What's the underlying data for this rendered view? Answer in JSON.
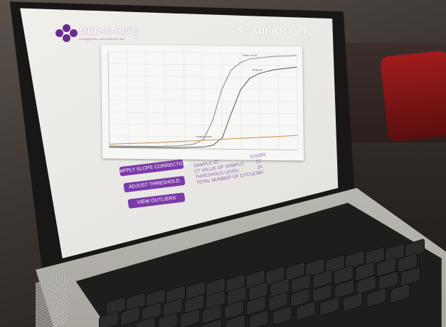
{
  "app": {
    "brand": "MED-E-HIVE",
    "tagline": "Changing lives, one device at a time",
    "product": "AutoGraph"
  },
  "actions": {
    "apply_slope": "APPLY SLOPE CORRECTION",
    "adjust_threshold": "ADJUST THRESHOLD",
    "view_outliers": "VIEW OUTLIERS"
  },
  "sample_info": {
    "sample_id_label": "SAMPLE ID:",
    "sample_id_value": "S16293",
    "ct_label": "CT VALUE OF SAMPLE:",
    "ct_value": "27",
    "threshold_label": "THRESHOLD LEVEL:",
    "threshold_value": "20",
    "cycles_label": "TOTAL NUMBER OF CYCLES:",
    "cycles_value": "40"
  },
  "chart_data": {
    "type": "line",
    "series": [
      {
        "name": "Positive control",
        "color": "#888888",
        "x": [
          0,
          5,
          10,
          15,
          18,
          20,
          22,
          24,
          26,
          28,
          30,
          35,
          40
        ],
        "y": [
          2,
          2,
          2,
          3,
          5,
          10,
          30,
          62,
          82,
          90,
          94,
          97,
          98
        ]
      },
      {
        "name": "Sample AB",
        "color": "#555555",
        "x": [
          0,
          5,
          10,
          15,
          20,
          22,
          24,
          26,
          28,
          30,
          32,
          35,
          40
        ],
        "y": [
          1,
          1,
          1,
          1,
          2,
          4,
          12,
          38,
          62,
          74,
          79,
          83,
          86
        ]
      },
      {
        "name": "Negative control",
        "color": "#c8944f",
        "x": [
          0,
          10,
          20,
          30,
          40
        ],
        "y": [
          4,
          6,
          9,
          12,
          15
        ]
      }
    ],
    "xlim": [
      0,
      40
    ],
    "ylim": [
      0,
      100
    ],
    "grid": true,
    "colors": {
      "grid": "#e3e3e3",
      "axis": "#b5b5b5"
    }
  },
  "colors": {
    "accent": "#7b3aa8"
  }
}
